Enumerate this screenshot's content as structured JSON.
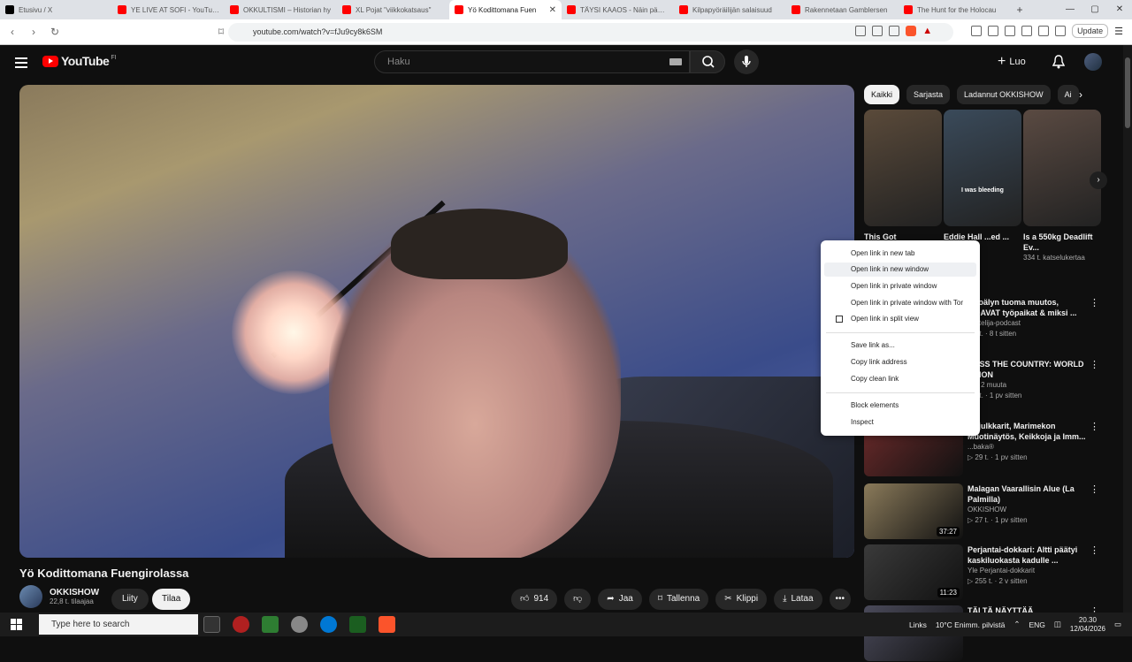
{
  "browser": {
    "tabs": [
      {
        "title": "Etusivu / X",
        "color": "#000000",
        "active": false
      },
      {
        "title": "YE LIVE AT SOFI - YouTube",
        "color": "#ff0000",
        "active": false
      },
      {
        "title": "OKKULTISMI – Historian hy",
        "color": "#ff0000",
        "active": false
      },
      {
        "title": "XL Pojat \"viikkokatsaus\"",
        "color": "#ff0000",
        "active": false
      },
      {
        "title": "Yö Kodittomana Fuen",
        "color": "#ff0000",
        "active": true
      },
      {
        "title": "TÄYSI KAAOS - Näin päätty",
        "color": "#ff0000",
        "active": false
      },
      {
        "title": "Kilpapyöräilijän salaisuud",
        "color": "#ff0000",
        "active": false
      },
      {
        "title": "Rakennetaan Gamblersen",
        "color": "#ff0000",
        "active": false
      },
      {
        "title": "The Hunt for the Holocau",
        "color": "#ff0000",
        "active": false
      }
    ],
    "new_tab": "+",
    "close_x": "✕",
    "url": "youtube.com/watch?v=fJu9cy8k6SM",
    "update_label": "Update",
    "window_controls": [
      "—",
      "▢",
      "✕"
    ]
  },
  "youtube": {
    "logo_text": "YouTube",
    "country": "FI",
    "search_placeholder": "Haku",
    "create_label": "Luo",
    "create_plus": "+",
    "video_title": "Yö Kodittomana Fuengirolassa",
    "channel_name": "OKKISHOW",
    "channel_subs": "22,8 t. tilaajaa",
    "join_label": "Liity",
    "subscribe_label": "Tilaa",
    "likes": "914",
    "share": "Jaa",
    "save": "Tallenna",
    "clip": "Klippi",
    "download": "Lataa",
    "more": "•••",
    "chips": [
      "Kaikki",
      "Sarjasta",
      "Ladannut OKKISHOW",
      "Ai"
    ],
    "shorts": [
      {
        "title": "This Got",
        "meta": "",
        "caption": "",
        "color": "#5a4a3a"
      },
      {
        "title": "Eddie Hall ...ed ...",
        "meta": "",
        "caption": "I was bleeding",
        "color": "#3a4a5a"
      },
      {
        "title": "Is a 550kg Deadlift Ev...",
        "meta": "334 t. katselukertaa",
        "caption": "",
        "color": "#5a4a42"
      }
    ],
    "recommendations": [
      {
        "title": "...koälyn tuoma muutos, ...OAVAT työpaikat & miksi ...",
        "channel": "...intelija-podcast",
        "meta": "...5 t. · 8 t sitten",
        "duration": "",
        "color": "#2a2a3a"
      },
      {
        "title": "...ESS THE COUNTRY: WORLD ...TION",
        "channel": "...ja 2 muuta",
        "meta": "...1 t. · 1 pv sitten",
        "duration": "",
        "color": "#2a3a2a"
      },
      {
        "title": "...yjulkkarit, Marimekon Muotinäytös, Keikkoja ja Imm...",
        "channel": "...baka®",
        "meta": "▷ 29 t. · 1 pv sitten",
        "duration": "",
        "color": "#6a2a2a"
      },
      {
        "title": "Malagan Vaarallisin Alue (La Palmilla)",
        "channel": "OKKISHOW",
        "meta": "▷ 27 t. · 1 pv sitten",
        "duration": "37:27",
        "color": "#8a7a5a"
      },
      {
        "title": "Perjantai-dokkari: Altti päätyi kaskiluokasta kadulle ...",
        "channel": "Yle Perjantai-dokkarit",
        "meta": "▷ 255 t. · 2 v sitten",
        "duration": "11:23",
        "color": "#3a3a3a"
      },
      {
        "title": "TÄLTÄ NÄYTTÄÄ",
        "channel": "",
        "meta": "",
        "duration": "",
        "color": "#4a4a5a"
      }
    ]
  },
  "context_menu": {
    "items": [
      "Open link in new tab",
      "Open link in new window",
      "Open link in private window",
      "Open link in private window with Tor",
      "Open link in split view",
      "Save link as...",
      "Copy link address",
      "Copy clean link",
      "Block elements",
      "Inspect"
    ]
  },
  "taskbar": {
    "search_placeholder": "Type here to search",
    "links": "Links",
    "weather": "10°C  Enimm. pilvistä",
    "lang": "ENG",
    "time": "20.30",
    "date": "12/04/2026"
  }
}
